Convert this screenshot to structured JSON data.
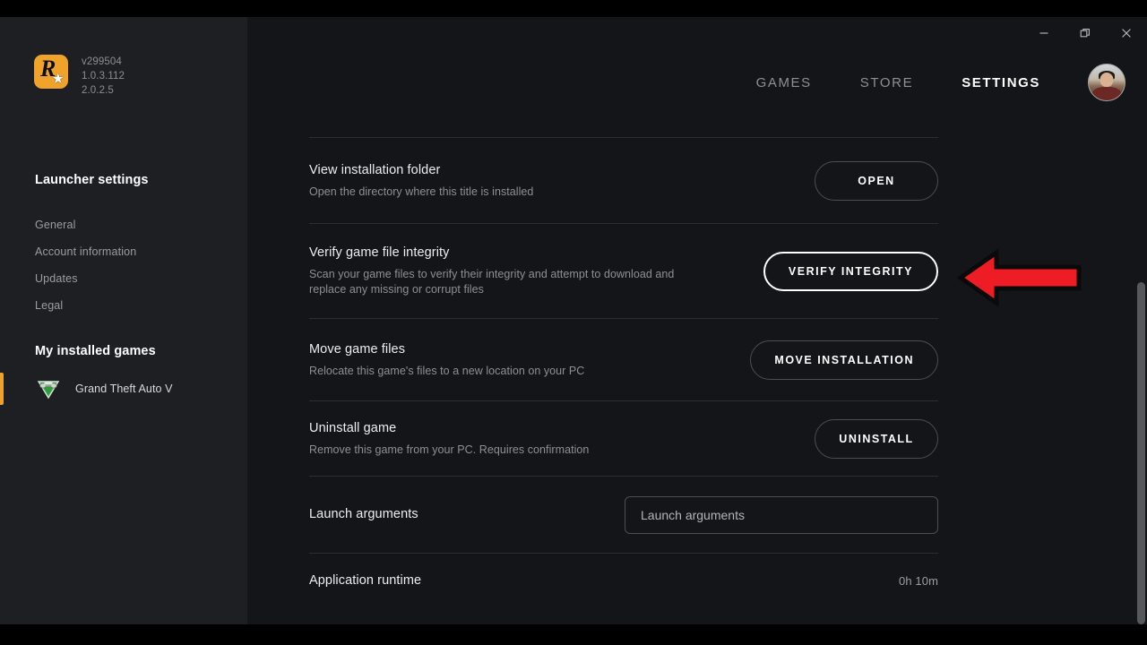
{
  "window": {
    "controls": [
      {
        "name": "minimize",
        "glyph": "minimize-icon"
      },
      {
        "name": "restore",
        "glyph": "restore-icon"
      },
      {
        "name": "close",
        "glyph": "close-icon"
      }
    ]
  },
  "sidebar": {
    "brand": {
      "logo_icon": "rockstar-logo-icon",
      "logo_color": "#f0a32a",
      "versions": [
        "v299504",
        "1.0.3.112",
        "2.0.2.5"
      ]
    },
    "launcher_settings_heading": "Launcher settings",
    "nav_items": [
      {
        "label": "General"
      },
      {
        "label": "Account information"
      },
      {
        "label": "Updates"
      },
      {
        "label": "Legal"
      }
    ],
    "installed_games_heading": "My installed games",
    "games": [
      {
        "label": "Grand Theft Auto V",
        "icon": "gta-v-icon",
        "active": true,
        "active_color": "#eda32b"
      }
    ]
  },
  "topnav": {
    "items": [
      {
        "label": "GAMES",
        "active": false
      },
      {
        "label": "STORE",
        "active": false
      },
      {
        "label": "SETTINGS",
        "active": true
      }
    ],
    "avatar_name": "user-avatar"
  },
  "settings": {
    "rows": [
      {
        "title": "View installation folder",
        "subtitle": "Open the directory where this title is installed",
        "button": "OPEN",
        "highlighted": false
      },
      {
        "title": "Verify game file integrity",
        "subtitle": "Scan your game files to verify their integrity and attempt to download and replace any missing or corrupt files",
        "button": "VERIFY INTEGRITY",
        "highlighted": true
      },
      {
        "title": "Move game files",
        "subtitle": "Relocate this game's files to a new location on your PC",
        "button": "MOVE INSTALLATION",
        "highlighted": false
      },
      {
        "title": "Uninstall game",
        "subtitle": "Remove this game from your PC. Requires confirmation",
        "button": "UNINSTALL",
        "highlighted": false
      }
    ],
    "launch_arguments": {
      "label": "Launch arguments",
      "value": "",
      "placeholder": "Launch arguments"
    },
    "application_runtime": {
      "label": "Application runtime",
      "value": "0h 10m"
    }
  },
  "annotation": {
    "arrow_icon": "red-left-arrow-icon",
    "arrow_color": "#ee1c25",
    "arrow_outline": "#0a0a0a",
    "points_at": "VERIFY INTEGRITY"
  },
  "scrollbar": {
    "name": "main-scrollbar",
    "thumb_color": "#55585d"
  }
}
